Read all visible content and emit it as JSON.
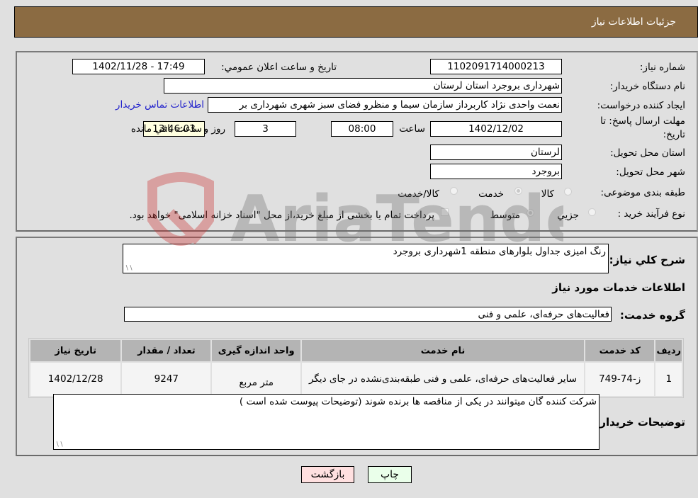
{
  "header": {
    "title": "جزئیات اطلاعات نیاز"
  },
  "details": {
    "need_number_label": "شماره نیاز:",
    "need_number": "1102091714000213",
    "announce_label": "تاریخ و ساعت اعلان عمومي:",
    "announce_value": "1402/11/28 - 17:49",
    "buyer_org_label": "نام دستگاه خریدار:",
    "buyer_org": "شهرداری بروجرد استان لرستان",
    "requester_label": "ایجاد کننده درخواست:",
    "requester": "نعمت واحدی نژاد کاربرداز سازمان سیما و منظرو فضای سبز شهری شهرداری بر",
    "contact_link": "اطلاعات تماس خریدار",
    "deadline_label_line1": "مهلت ارسال پاسخ: تا",
    "deadline_label_line2": "تاریخ:",
    "deadline_date": "1402/12/02",
    "time_label": "ساعت",
    "deadline_time": "08:00",
    "days_value": "3",
    "days_label": "روز و",
    "remaining_time": "13:46:03",
    "remaining_label": "ساعت باقي مانده",
    "province_label": "استان محل تحویل:",
    "province": "لرستان",
    "city_label": "شهر محل تحویل:",
    "city": "بروجرد",
    "category_label": "طبقه بندی موضوعی:",
    "category_options": [
      {
        "label": "کالا",
        "checked": false
      },
      {
        "label": "خدمت",
        "checked": true
      },
      {
        "label": "کالا/خدمت",
        "checked": false
      }
    ],
    "process_label": "نوع فرآیند خرید :",
    "process_options": [
      {
        "label": "جزيي",
        "checked": false
      },
      {
        "label": "متوسط",
        "checked": true
      }
    ],
    "payment_note": "پرداخت تمام یا بخشی از مبلغ خرید،از محل \"اسناد خزانه اسلامی\" خواهد بود.",
    "payment_checked": false
  },
  "description": {
    "label": "شرح کلي نیاز:",
    "value": "رنگ امیزی جداول بلوارهای منطقه 1شهرداری بروجرد"
  },
  "services": {
    "section_title": "اطلاعات خدمات مورد نیاز",
    "group_label": "گروه خدمت:",
    "group_value": "فعالیت‌های حرفه‌ای، علمی و فنی",
    "columns": [
      "ردیف",
      "کد خدمت",
      "نام خدمت",
      "واحد اندازه گیری",
      "تعداد / مقدار",
      "تاریخ نیاز"
    ],
    "rows": [
      {
        "index": "1",
        "code": "ز-74-749",
        "name": "سایر فعالیت‌های حرفه‌ای، علمی و فنی طبقه‌بندی‌نشده در جای دیگر",
        "unit": "متر مربع",
        "quantity": "9247",
        "date": "1402/12/28"
      }
    ]
  },
  "buyer_notes": {
    "label": "توضیحات خریدار:",
    "value": "شرکت کننده گان میتوانند در یکی از مناقصه ها برنده شوند (توضیحات پیوست شده است )"
  },
  "buttons": {
    "print": "چاپ",
    "back": "بازگشت"
  },
  "watermark": {
    "text": "AriaTender.neT"
  }
}
